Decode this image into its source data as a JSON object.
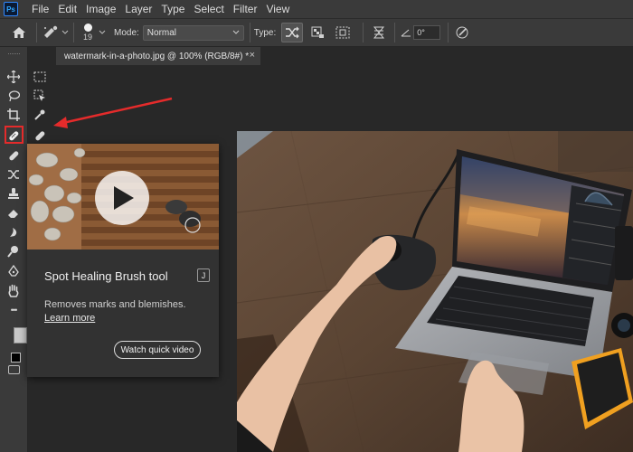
{
  "app": {
    "logo": "Ps"
  },
  "menu": [
    "File",
    "Edit",
    "Image",
    "Layer",
    "Type",
    "Select",
    "Filter",
    "View"
  ],
  "options": {
    "brush_size": "19",
    "mode_label": "Mode:",
    "mode_value": "Normal",
    "type_label": "Type:",
    "angle_value": "0°"
  },
  "document": {
    "tab_title": "watermark-in-a-photo.jpg @ 100% (RGB/8#) *",
    "close_glyph": "×"
  },
  "tooltip": {
    "title": "Spot Healing Brush tool",
    "shortcut": "J",
    "description": "Removes marks and blemishes.",
    "learn_more": "Learn more",
    "video_button": "Watch quick video"
  },
  "toolbar": {
    "more_glyph": "•••"
  },
  "colors": {
    "annotation_red": "#e52b2b",
    "ui_dark": "#3a3a3a",
    "workspace": "#282828"
  },
  "icons": [
    "home-icon",
    "brush-preset-icon",
    "mode-dropdown-icon",
    "proximity-match-icon",
    "create-texture-icon",
    "content-aware-icon",
    "sample-all-layers-icon",
    "angle-icon",
    "pressure-icon",
    "move-tool-icon",
    "marquee-tool-icon",
    "lasso-tool-icon",
    "object-select-icon",
    "crop-tool-icon",
    "eyedropper-tool-icon",
    "spot-healing-brush-icon",
    "healing-brush-icon",
    "brush-tool-icon",
    "clone-stamp-icon",
    "history-brush-icon",
    "eraser-icon",
    "gradient-icon",
    "smudge-icon",
    "dodge-icon",
    "pen-icon",
    "hand-tool-icon",
    "more-tools-icon",
    "foreground-color-icon",
    "background-color-icon",
    "quick-mask-icon",
    "play-icon"
  ]
}
